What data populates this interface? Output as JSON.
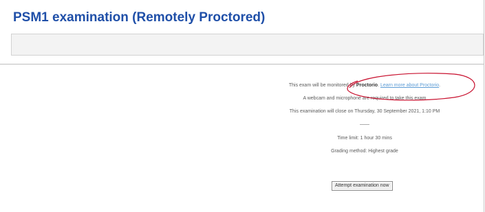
{
  "page": {
    "title": "PSM1 examination (Remotely Proctored)"
  },
  "info": {
    "monitor_prefix": "This exam will be monitored by",
    "monitor_service": "Proctorio",
    "monitor_link": "Learn more about Proctorio",
    "requirements": "A webcam and microphone are required to take this exam",
    "closing": "This examination will close on Thursday, 30 September 2021, 1:10 PM",
    "separator": "——",
    "time_limit": "Time limit: 1 hour 30 mins",
    "grading": "Grading method: Highest grade"
  },
  "actions": {
    "attempt_label": "Attempt examination now"
  },
  "colors": {
    "title": "#1f4fa8",
    "link": "#5b9bd5",
    "annotation": "#c8102e"
  }
}
